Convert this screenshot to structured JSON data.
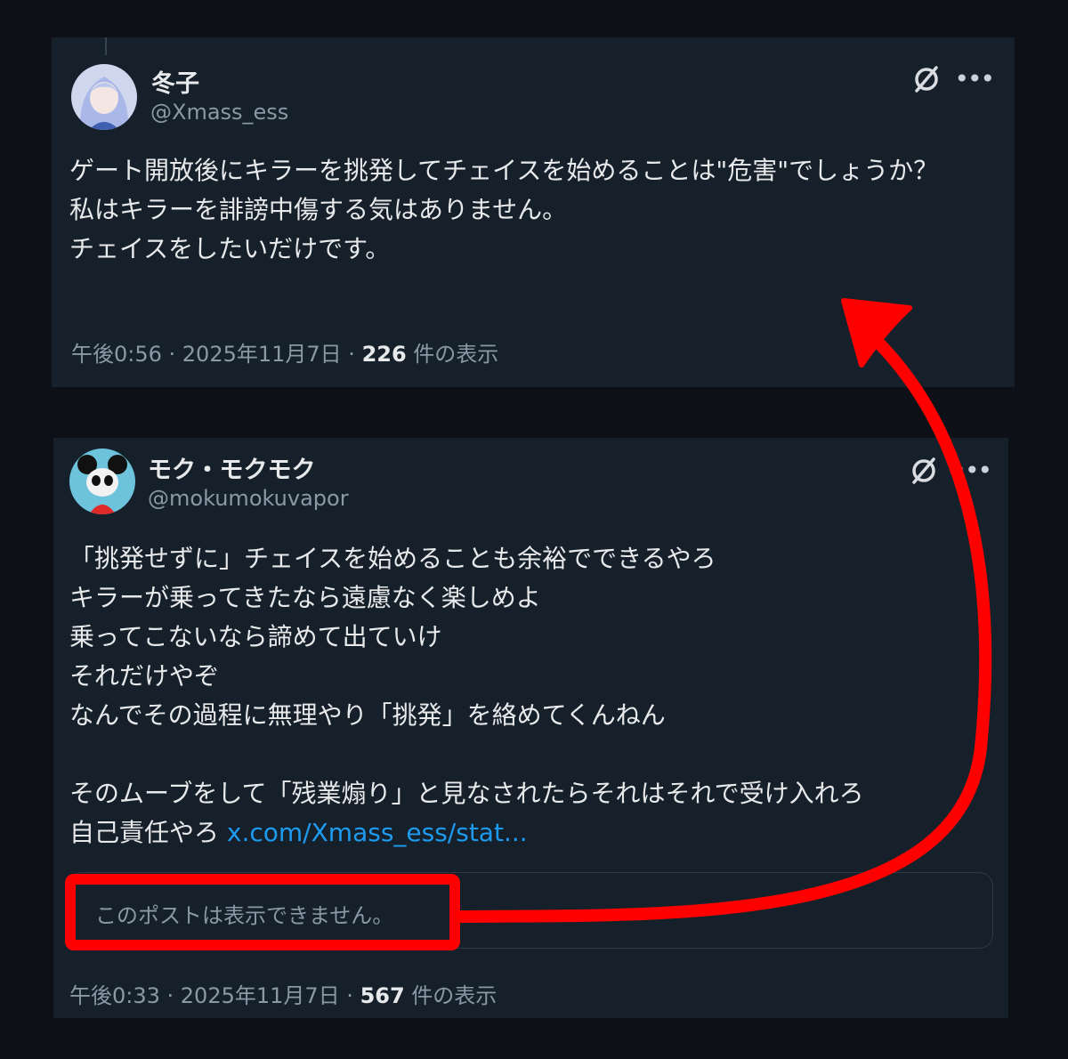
{
  "posts": [
    {
      "author": {
        "name": "冬子",
        "handle": "@Xmass_ess"
      },
      "text": "ゲート開放後にキラーを挑発してチェイスを始めることは\"危害\"でしょうか？\n私はキラーを誹謗中傷する気はありません。\nチェイスをしたいだけです。",
      "meta": {
        "time": "午後0:56 · 2025年11月7日 · ",
        "views": "226",
        "views_suffix": " 件の表示"
      },
      "icons": [
        "grok-icon",
        "more-icon"
      ]
    },
    {
      "author": {
        "name": "モク・モクモク",
        "handle": "@mokumokuvapor"
      },
      "text": "「挑発せずに」チェイスを始めることも余裕でできるやろ\nキラーが乗ってきたなら遠慮なく楽しめよ\n乗ってこないなら諦めて出ていけ\nそれだけやぞ\nなんでその過程に無理やり「挑発」を絡めてくんねん\n\nそのムーブをして「残業煽り」と見なされたらそれはそれで受け入れろ\n自己責任やろ ",
      "link": "x.com/Xmass_ess/stat...",
      "quote": {
        "text": "このポストは表示できません。"
      },
      "meta": {
        "time": "午後0:33 · 2025年11月7日 · ",
        "views": "567",
        "views_suffix": " 件の表示"
      },
      "icons": [
        "grok-icon",
        "more-icon"
      ]
    }
  ],
  "colors": {
    "background": "#0d1117",
    "card": "#16202b",
    "text": "#e7e9ea",
    "muted": "#8b98a5",
    "link": "#1d9bf0",
    "annotation": "#ff0000"
  }
}
